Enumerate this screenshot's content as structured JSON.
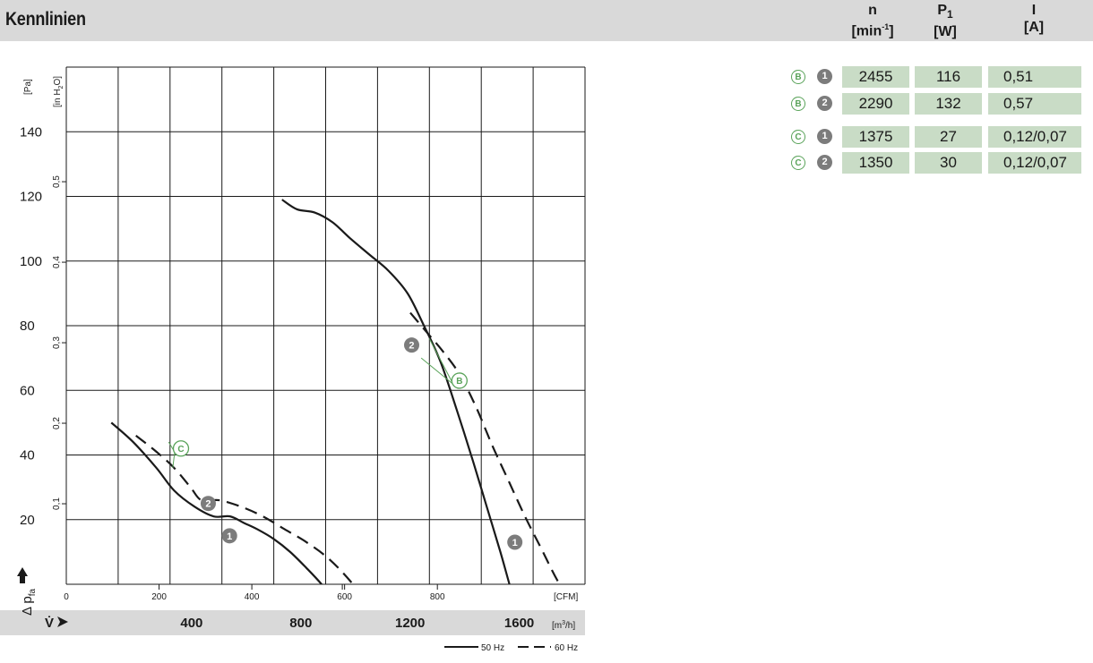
{
  "header": {
    "title": "Kennlinien",
    "columns": [
      {
        "symbol": "n",
        "unit": "[min",
        "unit_sup": "-1",
        "unit_end": "]"
      },
      {
        "symbol": "P",
        "symbol_sub": "1",
        "unit": "[W]"
      },
      {
        "symbol": "I",
        "unit": "[A]"
      }
    ]
  },
  "table": {
    "rows": [
      {
        "curve": "B",
        "point": "1",
        "n": "2455",
        "p1": "116",
        "i": "0,51"
      },
      {
        "curve": "B",
        "point": "2",
        "n": "2290",
        "p1": "132",
        "i": "0,57"
      },
      {
        "curve": "C",
        "point": "1",
        "n": "1375",
        "p1": "27",
        "i": "0,12/0,07"
      },
      {
        "curve": "C",
        "point": "2",
        "n": "1350",
        "p1": "30",
        "i": "0,12/0,07"
      }
    ]
  },
  "chart_data": {
    "type": "line",
    "y_axis_pa": {
      "unit": "[Pa]",
      "ticks": [
        "20",
        "40",
        "60",
        "80",
        "100",
        "120",
        "140"
      ],
      "range": [
        0,
        160
      ]
    },
    "y_axis_inh2o": {
      "unit_main": "[in H",
      "unit_sub": "2",
      "unit_end": "O]",
      "ticks": [
        "0,1",
        "0,2",
        "0,3",
        "0,4",
        "0,5"
      ]
    },
    "y_label": {
      "main": "Δ p",
      "sub": "fa"
    },
    "x_axis_cfm": {
      "unit": "[CFM]",
      "ticks": [
        "0",
        "200",
        "400",
        "600",
        "800"
      ]
    },
    "x_axis_m3h": {
      "unit_main": "[m",
      "unit_sup": "3",
      "unit_end": "/h]",
      "ticks": [
        "400",
        "800",
        "1200",
        "1600"
      ],
      "range": [
        0,
        1900
      ]
    },
    "x_label": "V̇",
    "grid": true,
    "legend": {
      "solid": "50 Hz",
      "dashed": "60 Hz",
      "position": "bottom-right"
    },
    "series": [
      {
        "curve": "C",
        "style": "solid",
        "x": [
          165,
          245,
          330,
          395,
          470,
          540,
          600,
          650,
          700,
          760,
          820,
          880,
          935,
          990,
          1015
        ],
        "y": [
          50,
          44,
          36,
          29,
          24,
          21,
          21,
          19,
          17,
          14,
          10,
          5,
          0,
          -6,
          -10
        ]
      },
      {
        "curve": "C",
        "style": "dashed",
        "x": [
          255,
          330,
          395,
          455,
          495,
          560,
          640,
          720,
          800,
          880,
          960,
          1040,
          1110,
          1150
        ],
        "y": [
          46,
          41,
          36,
          30,
          26,
          26,
          24,
          21,
          17,
          13,
          8,
          1,
          -7,
          -12
        ]
      },
      {
        "curve": "B",
        "style": "solid",
        "x": [
          790,
          845,
          910,
          975,
          1040,
          1110,
          1180,
          1250,
          1310,
          1370,
          1430,
          1490,
          1540,
          1590,
          1630,
          1660
        ],
        "y": [
          119,
          116,
          115,
          112,
          107,
          102,
          97,
          90,
          80,
          69,
          54,
          38,
          24,
          10,
          -2,
          -10
        ]
      },
      {
        "curve": "B",
        "style": "dashed",
        "x": [
          1260,
          1320,
          1380,
          1440,
          1500,
          1560,
          1620,
          1680,
          1740,
          1800,
          1880
        ],
        "y": [
          84,
          78,
          72,
          65,
          55,
          43,
          32,
          21,
          11,
          1,
          -10
        ]
      }
    ],
    "point_markers": [
      {
        "curve": "B",
        "label": "2",
        "x": 1265,
        "y": 74
      },
      {
        "curve": "B",
        "label": "1",
        "x": 1643,
        "y": 13
      },
      {
        "curve": "C",
        "label": "2",
        "x": 520,
        "y": 25
      },
      {
        "curve": "C",
        "label": "1",
        "x": 598,
        "y": 15
      }
    ],
    "curve_labels": [
      {
        "label": "B",
        "x": 1440,
        "y": 63
      },
      {
        "label": "C",
        "x": 420,
        "y": 42
      }
    ]
  }
}
